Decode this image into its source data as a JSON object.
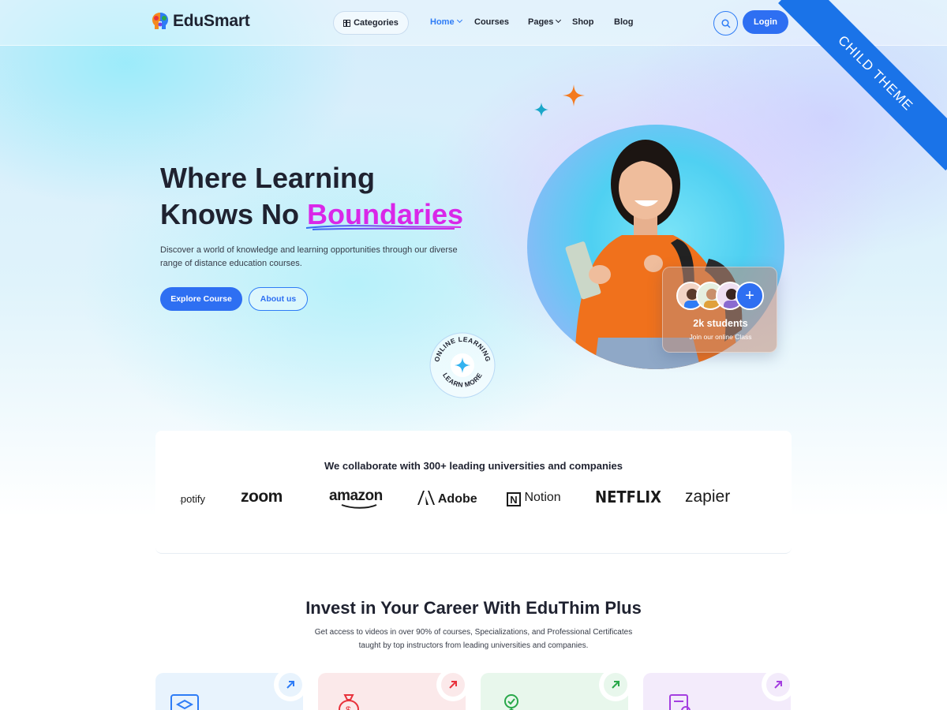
{
  "brand": {
    "name": "EduSmart"
  },
  "header": {
    "categories_label": "Categories",
    "nav": [
      {
        "label": "Home",
        "active": true,
        "has_dropdown": true
      },
      {
        "label": "Courses",
        "active": false,
        "has_dropdown": false
      },
      {
        "label": "Pages",
        "active": false,
        "has_dropdown": true
      },
      {
        "label": "Shop",
        "active": false,
        "has_dropdown": false
      },
      {
        "label": "Blog",
        "active": false,
        "has_dropdown": false
      }
    ],
    "login_label": "Login"
  },
  "ribbon": {
    "label": "CHILD THEME"
  },
  "hero": {
    "title_line1": "Where Learning",
    "title_line2_prefix": "Knows No ",
    "title_highlight": "Boundaries",
    "description": "Discover a world of knowledge and learning opportunities through our diverse range of distance education courses.",
    "primary_button": "Explore Course",
    "secondary_button": "About us",
    "badge_text_top": "ONLINE LEARNING",
    "badge_text_bottom": "LEARN MORE"
  },
  "students_card": {
    "count": "2k students",
    "subtitle": "Join our online Class"
  },
  "partners": {
    "title": "We collaborate with 300+ leading universities and companies",
    "logos": [
      "spotify",
      "zoom",
      "amazon",
      "Adobe",
      "Notion",
      "NETFLIX",
      "zapier"
    ]
  },
  "invest": {
    "title": "Invest in Your Career With EduThim Plus",
    "description": "Get access to videos in over 90% of courses, Specializations, and Professional Certificates taught by top instructors from leading universities and companies."
  },
  "feature_cards": [
    {
      "icon": "graduation-cap-icon",
      "bg": "#e8f3fd",
      "accent": "#2e7cf6"
    },
    {
      "icon": "money-bag-icon",
      "bg": "#fbe9ea",
      "accent": "#e8323c"
    },
    {
      "icon": "certificate-icon",
      "bg": "#e8f7ec",
      "accent": "#29a84a"
    },
    {
      "icon": "document-icon",
      "bg": "#f3ebfb",
      "accent": "#a43fe0"
    }
  ],
  "colors": {
    "accent": "#2e6ff2",
    "highlight": "#d927e8",
    "ribbon": "#1a73e8"
  }
}
